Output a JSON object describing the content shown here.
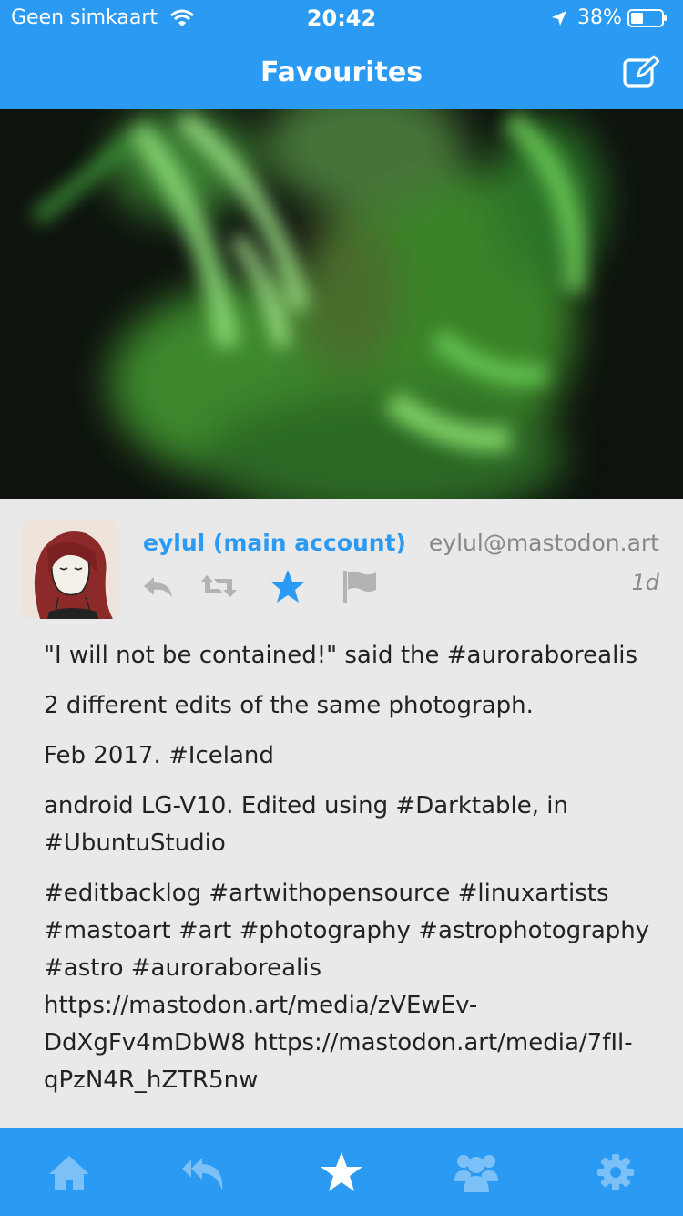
{
  "status_bar": {
    "carrier": "Geen simkaart",
    "time": "20:42",
    "battery": "38%"
  },
  "header": {
    "title": "Favourites",
    "compose_icon": "compose-icon"
  },
  "media": {
    "expand_icon": "plus-icon"
  },
  "post": {
    "display_name": "eylul (main account)",
    "handle": "eylul@mastodon.art",
    "time_ago": "1d",
    "actions": [
      "reply-icon",
      "boost-icon",
      "favourite-icon",
      "report-icon"
    ],
    "paragraphs": [
      "\"I will not be contained!\" said the #auroraborealis",
      "2 different edits of the same photograph.",
      "Feb 2017. #Iceland",
      "android LG-V10. Edited using #Darktable, in #UbuntuStudio",
      "#editbacklog #artwithopensource #linuxartists #mastoart #art #photography #astrophotography #astro #auroraborealis https://mastodon.art/media/zVEwEv-DdXgFv4mDbW8 https://mastodon.art/media/7fIl-qPzN4R_hZTR5nw"
    ]
  },
  "tab_bar": {
    "tabs": [
      "home-icon",
      "replies-icon",
      "favourites-icon",
      "people-icon",
      "settings-icon"
    ]
  },
  "colors": {
    "accent": "#2b9af3",
    "inactive_icon": "#b3b3b3"
  }
}
